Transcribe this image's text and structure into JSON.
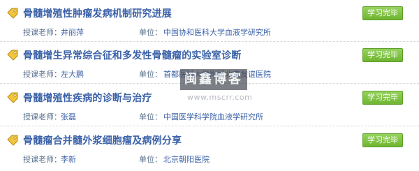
{
  "courses": [
    {
      "title": "骨髓增殖性肿瘤发病机制研究进展",
      "status": "学习完毕",
      "teacher_label": "授课老师：",
      "teacher": "井丽萍",
      "unit_label": "单位：",
      "unit": "中国协和医科大学血液学研究所"
    },
    {
      "title": "骨髓增生异常综合征和多发性骨髓瘤的实验室诊断",
      "status": "学习完毕",
      "teacher_label": "授课老师：",
      "teacher": "左大鹏",
      "unit_label": "单位：",
      "unit": "首都医科大学附属北京友谊医院"
    },
    {
      "title": "骨髓增殖性疾病的诊断与治疗",
      "status": "学习完毕",
      "teacher_label": "授课老师：",
      "teacher": "张磊",
      "unit_label": "单位：",
      "unit": "中国医学科学院血液学研究所"
    },
    {
      "title": "骨髓瘤合并髓外浆细胞瘤及病例分享",
      "status": "学习完毕",
      "teacher_label": "授课老师：",
      "teacher": "李新",
      "unit_label": "单位：",
      "unit": "北京朝阳医院"
    }
  ],
  "watermark": {
    "main": "闽鑫博客",
    "url": "www.mscrr.com"
  },
  "colors": {
    "title": "#3a61a8",
    "status_bg": "#7cc142",
    "meta_text": "#5a6f8c"
  },
  "icons": {
    "course_tag": "tag-icon"
  }
}
